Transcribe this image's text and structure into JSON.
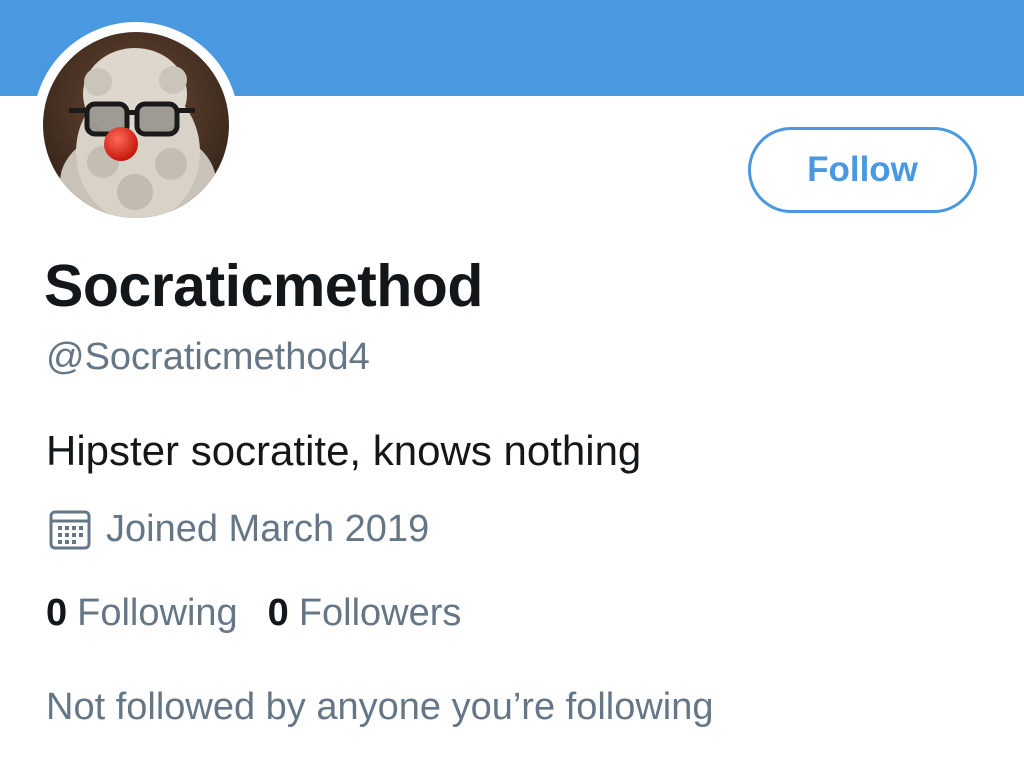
{
  "banner": {
    "color": "#4a98df"
  },
  "avatar": {
    "description_icon": "profile-avatar"
  },
  "follow_button": {
    "label": "Follow"
  },
  "profile": {
    "display_name": "Socraticmethod",
    "handle": "@Socraticmethod4",
    "bio": "Hipster socratite, knows nothing",
    "joined": "Joined March 2019"
  },
  "stats": {
    "following_count": "0",
    "following_label": "Following",
    "followers_count": "0",
    "followers_label": "Followers"
  },
  "social_context": "Not followed by anyone you’re following",
  "colors": {
    "accent": "#4a98df",
    "text_primary": "#14171a",
    "text_secondary": "#657786"
  }
}
